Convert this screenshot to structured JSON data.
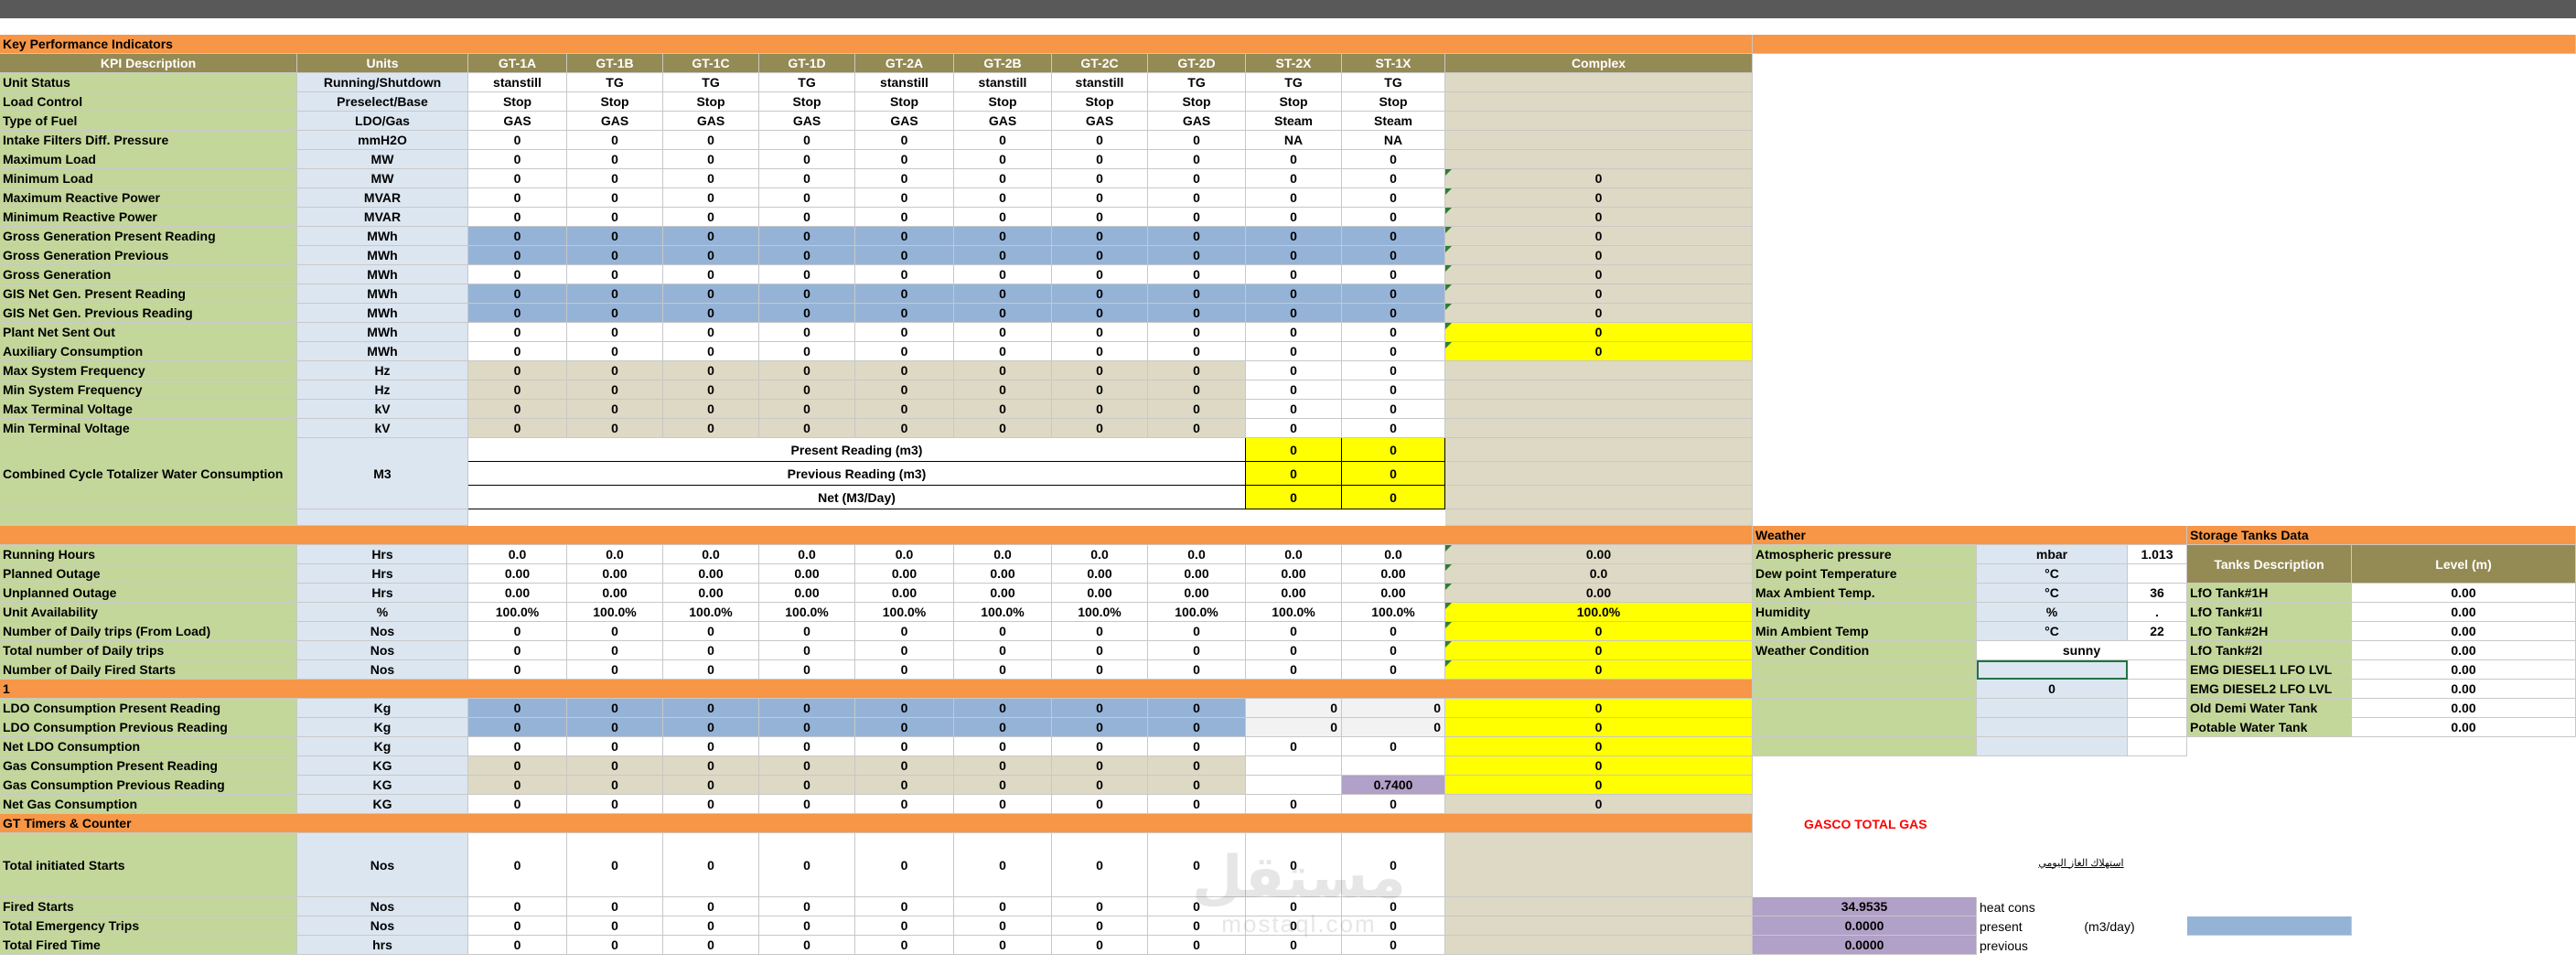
{
  "kpi_section_title": "Key Performance Indicators",
  "header": {
    "kpi_description": "KPI Description",
    "units": "Units",
    "units_list": [
      "GT-1A",
      "GT-1B",
      "GT-1C",
      "GT-1D",
      "GT-2A",
      "GT-2B",
      "GT-2C",
      "GT-2D",
      "ST-2X",
      "ST-1X"
    ],
    "complex": "Complex"
  },
  "kpi_rows": [
    {
      "label": "Unit Status",
      "unit": "Running/Shutdown",
      "values": [
        "stanstill",
        "TG",
        "TG",
        "TG",
        "stanstill",
        "stanstill",
        "stanstill",
        "TG",
        "TG",
        "TG"
      ],
      "complex": ""
    },
    {
      "label": "Load Control",
      "unit": "Preselect/Base",
      "values": [
        "Stop",
        "Stop",
        "Stop",
        "Stop",
        "Stop",
        "Stop",
        "Stop",
        "Stop",
        "Stop",
        "Stop"
      ],
      "complex": ""
    },
    {
      "label": "Type of Fuel",
      "unit": "LDO/Gas",
      "values": [
        "GAS",
        "GAS",
        "GAS",
        "GAS",
        "GAS",
        "GAS",
        "GAS",
        "GAS",
        "Steam",
        "Steam"
      ],
      "complex": ""
    },
    {
      "label": "Intake Filters Diff. Pressure",
      "unit": "mmH2O",
      "values": [
        "0",
        "0",
        "0",
        "0",
        "0",
        "0",
        "0",
        "0",
        "NA",
        "NA"
      ],
      "complex": ""
    },
    {
      "label": "Maximum Load",
      "unit": "MW",
      "values": [
        "0",
        "0",
        "0",
        "0",
        "0",
        "0",
        "0",
        "0",
        "0",
        "0"
      ],
      "complex": ""
    },
    {
      "label": "Minimum Load",
      "unit": "MW",
      "values": [
        "0",
        "0",
        "0",
        "0",
        "0",
        "0",
        "0",
        "0",
        "0",
        "0"
      ],
      "complex": "0"
    },
    {
      "label": "Maximum Reactive Power",
      "unit": "MVAR",
      "values": [
        "0",
        "0",
        "0",
        "0",
        "0",
        "0",
        "0",
        "0",
        "0",
        "0"
      ],
      "complex": "0"
    },
    {
      "label": "Minimum Reactive Power",
      "unit": "MVAR",
      "values": [
        "0",
        "0",
        "0",
        "0",
        "0",
        "0",
        "0",
        "0",
        "0",
        "0"
      ],
      "complex": "0"
    },
    {
      "label": "Gross Generation Present Reading",
      "unit": "MWh",
      "values": [
        "0",
        "0",
        "0",
        "0",
        "0",
        "0",
        "0",
        "0",
        "0",
        "0"
      ],
      "complex": "0"
    },
    {
      "label": "Gross Generation Previous",
      "unit": "MWh",
      "values": [
        "0",
        "0",
        "0",
        "0",
        "0",
        "0",
        "0",
        "0",
        "0",
        "0"
      ],
      "complex": "0"
    },
    {
      "label": "Gross Generation",
      "unit": "MWh",
      "values": [
        "0",
        "0",
        "0",
        "0",
        "0",
        "0",
        "0",
        "0",
        "0",
        "0"
      ],
      "complex": "0"
    },
    {
      "label": "GIS Net Gen. Present Reading",
      "unit": "MWh",
      "values": [
        "0",
        "0",
        "0",
        "0",
        "0",
        "0",
        "0",
        "0",
        "0",
        "0"
      ],
      "complex": "0"
    },
    {
      "label": "GIS Net Gen. Previous Reading",
      "unit": "MWh",
      "values": [
        "0",
        "0",
        "0",
        "0",
        "0",
        "0",
        "0",
        "0",
        "0",
        "0"
      ],
      "complex": "0"
    },
    {
      "label": "Plant Net Sent Out",
      "unit": "MWh",
      "values": [
        "0",
        "0",
        "0",
        "0",
        "0",
        "0",
        "0",
        "0",
        "0",
        "0"
      ],
      "complex": "0"
    },
    {
      "label": "Auxiliary Consumption",
      "unit": "MWh",
      "values": [
        "0",
        "0",
        "0",
        "0",
        "0",
        "0",
        "0",
        "0",
        "0",
        "0"
      ],
      "complex": "0"
    },
    {
      "label": "Max System Frequency",
      "unit": "Hz",
      "values": [
        "0",
        "0",
        "0",
        "0",
        "0",
        "0",
        "0",
        "0",
        "0",
        "0"
      ],
      "complex": ""
    },
    {
      "label": "Min System Frequency",
      "unit": "Hz",
      "values": [
        "0",
        "0",
        "0",
        "0",
        "0",
        "0",
        "0",
        "0",
        "0",
        "0"
      ],
      "complex": ""
    },
    {
      "label": "Max Terminal Voltage",
      "unit": "kV",
      "values": [
        "0",
        "0",
        "0",
        "0",
        "0",
        "0",
        "0",
        "0",
        "0",
        "0"
      ],
      "complex": ""
    },
    {
      "label": "Min Terminal Voltage",
      "unit": "kV",
      "values": [
        "0",
        "0",
        "0",
        "0",
        "0",
        "0",
        "0",
        "0",
        "0",
        "0"
      ],
      "complex": ""
    }
  ],
  "water": {
    "label": "Combined Cycle Totalizer Water Consumption",
    "unit": "M3",
    "rows": [
      {
        "label": "Present Reading (m3)",
        "st2x": "0",
        "st1x": "0"
      },
      {
        "label": "Previous Reading (m3)",
        "st2x": "0",
        "st1x": "0"
      },
      {
        "label": "Net (M3/Day)",
        "st2x": "0",
        "st1x": "0"
      }
    ]
  },
  "hours_rows": [
    {
      "label": "Running Hours",
      "unit": "Hrs",
      "values": [
        "0.0",
        "0.0",
        "0.0",
        "0.0",
        "0.0",
        "0.0",
        "0.0",
        "0.0",
        "0.0",
        "0.0"
      ],
      "complex": "0.00"
    },
    {
      "label": "Planned Outage",
      "unit": "Hrs",
      "values": [
        "0.00",
        "0.00",
        "0.00",
        "0.00",
        "0.00",
        "0.00",
        "0.00",
        "0.00",
        "0.00",
        "0.00"
      ],
      "complex": "0.0"
    },
    {
      "label": "Unplanned Outage",
      "unit": "Hrs",
      "values": [
        "0.00",
        "0.00",
        "0.00",
        "0.00",
        "0.00",
        "0.00",
        "0.00",
        "0.00",
        "0.00",
        "0.00"
      ],
      "complex": "0.00"
    },
    {
      "label": "Unit Availability",
      "unit": "%",
      "values": [
        "100.0%",
        "100.0%",
        "100.0%",
        "100.0%",
        "100.0%",
        "100.0%",
        "100.0%",
        "100.0%",
        "100.0%",
        "100.0%"
      ],
      "complex": "100.0%"
    },
    {
      "label": "Number of Daily trips (From Load)",
      "unit": "Nos",
      "values": [
        "0",
        "0",
        "0",
        "0",
        "0",
        "0",
        "0",
        "0",
        "0",
        "0"
      ],
      "complex": "0"
    },
    {
      "label": "Total number of Daily trips",
      "unit": "Nos",
      "values": [
        "0",
        "0",
        "0",
        "0",
        "0",
        "0",
        "0",
        "0",
        "0",
        "0"
      ],
      "complex": "0"
    },
    {
      "label": "Number of Daily Fired Starts",
      "unit": "Nos",
      "values": [
        "0",
        "0",
        "0",
        "0",
        "0",
        "0",
        "0",
        "0",
        "0",
        "0"
      ],
      "complex": "0"
    }
  ],
  "separator_label": "1",
  "fuel_rows": [
    {
      "label": "LDO Consumption Present Reading",
      "unit": "Kg",
      "values": [
        "0",
        "0",
        "0",
        "0",
        "0",
        "0",
        "0",
        "0",
        "0",
        "0"
      ],
      "complex": "0"
    },
    {
      "label": "LDO Consumption Previous Reading",
      "unit": "Kg",
      "values": [
        "0",
        "0",
        "0",
        "0",
        "0",
        "0",
        "0",
        "0",
        "0",
        "0"
      ],
      "complex": "0"
    },
    {
      "label": "Net LDO Consumption",
      "unit": "Kg",
      "values": [
        "0",
        "0",
        "0",
        "0",
        "0",
        "0",
        "0",
        "0",
        "0",
        "0"
      ],
      "complex": "0"
    },
    {
      "label": "Gas Consumption Present Reading",
      "unit": "KG",
      "values": [
        "0",
        "0",
        "0",
        "0",
        "0",
        "0",
        "0",
        "0",
        "",
        ""
      ],
      "complex": "0"
    },
    {
      "label": "Gas Consumption Previous Reading",
      "unit": "KG",
      "values": [
        "0",
        "0",
        "0",
        "0",
        "0",
        "0",
        "0",
        "0",
        "",
        "0.7400"
      ],
      "complex": "0"
    },
    {
      "label": "Net Gas Consumption",
      "unit": "KG",
      "values": [
        "0",
        "0",
        "0",
        "0",
        "0",
        "0",
        "0",
        "0",
        "0",
        "0"
      ],
      "complex": "0"
    }
  ],
  "gt_timers_title": "GT Timers & Counter",
  "timer_rows": [
    {
      "label": "Total initiated Starts",
      "unit": "Nos",
      "values": [
        "0",
        "0",
        "0",
        "0",
        "0",
        "0",
        "0",
        "0",
        "0",
        "0"
      ]
    },
    {
      "label": "Fired Starts",
      "unit": "Nos",
      "values": [
        "0",
        "0",
        "0",
        "0",
        "0",
        "0",
        "0",
        "0",
        "0",
        "0"
      ]
    },
    {
      "label": "Total Emergency Trips",
      "unit": "Nos",
      "values": [
        "0",
        "0",
        "0",
        "0",
        "0",
        "0",
        "0",
        "0",
        "0",
        "0"
      ]
    },
    {
      "label": "Total Fired Time",
      "unit": "hrs",
      "values": [
        "0",
        "0",
        "0",
        "0",
        "0",
        "0",
        "0",
        "0",
        "0",
        "0"
      ]
    }
  ],
  "weather": {
    "title": "Weather",
    "rows": [
      {
        "label": "Atmospheric pressure",
        "unit": "mbar",
        "value": "1.013"
      },
      {
        "label": "Dew point Temperature",
        "unit": "°C",
        "value": ""
      },
      {
        "label": "Max Ambient Temp.",
        "unit": "°C",
        "value": "36"
      },
      {
        "label": "Humidity",
        "unit": "%",
        "value": "."
      },
      {
        "label": "Min Ambient Temp",
        "unit": "°C",
        "value": "22"
      },
      {
        "label": "Weather Condition",
        "unit": "",
        "value": "sunny"
      }
    ],
    "extra_value": "0"
  },
  "storage": {
    "title": "Storage Tanks Data",
    "col_desc": "Tanks Description",
    "col_level": "Level (m)",
    "rows": [
      {
        "name": "LfO Tank#1H",
        "level": "0.00"
      },
      {
        "name": "LfO Tank#1I",
        "level": "0.00"
      },
      {
        "name": "LfO Tank#2H",
        "level": "0.00"
      },
      {
        "name": "LfO Tank#2I",
        "level": "0.00"
      },
      {
        "name": "EMG DIESEL1 LFO LVL",
        "level": "0.00"
      },
      {
        "name": "EMG DIESEL2 LFO LVL",
        "level": "0.00"
      },
      {
        "name": "Old Demi Water Tank",
        "level": "0.00"
      },
      {
        "name": "Potable Water Tank",
        "level": "0.00"
      }
    ]
  },
  "gasco": {
    "title": "GASCO TOTAL GAS",
    "arabic_note": "استهلاك الغاز اليومي",
    "rows": [
      {
        "value": "34.9535",
        "label": "heat cons",
        "unit": ""
      },
      {
        "value": "0.0000",
        "label": "present",
        "unit": "(m3/day)"
      },
      {
        "value": "0.0000",
        "label": "previous",
        "unit": ""
      }
    ]
  },
  "watermark": {
    "arabic": "مستقل",
    "latin": "mostaql.com"
  }
}
